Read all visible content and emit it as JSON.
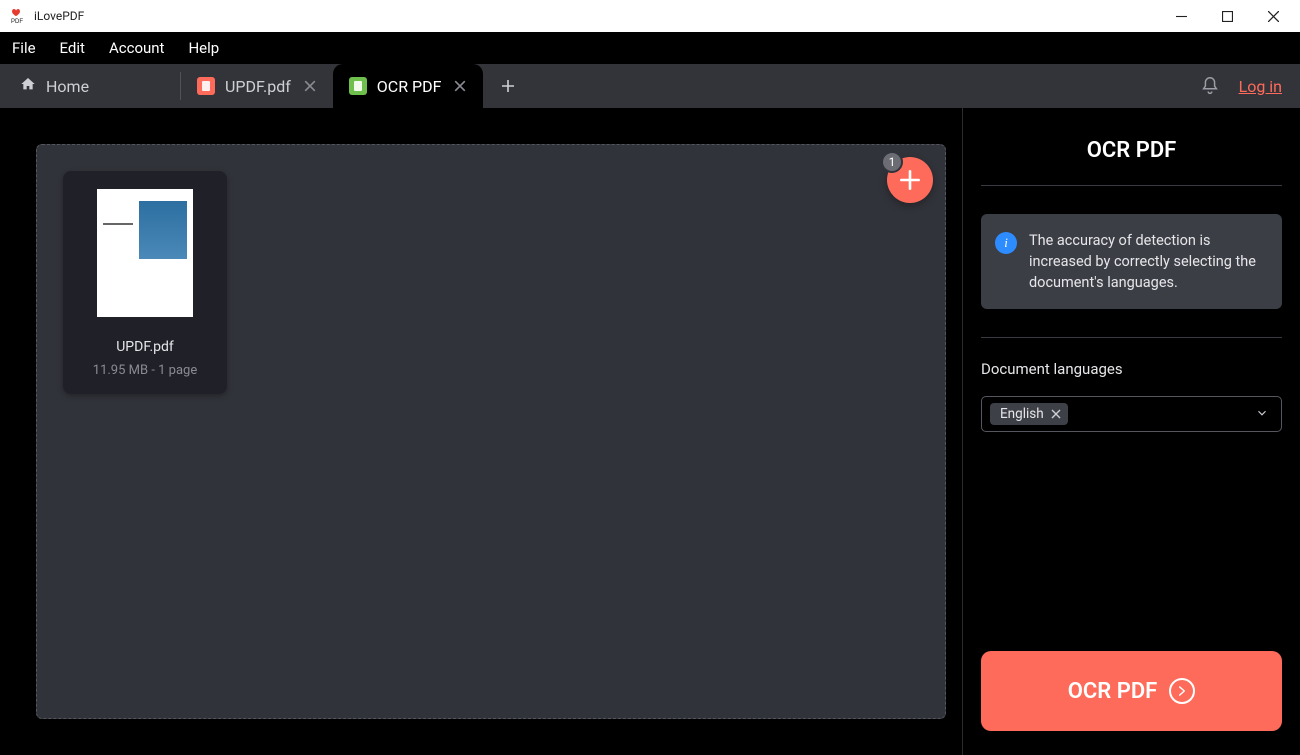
{
  "app": {
    "title": "iLovePDF"
  },
  "menu": {
    "file": "File",
    "edit": "Edit",
    "account": "Account",
    "help": "Help"
  },
  "tabs": {
    "home": "Home",
    "items": [
      {
        "label": "UPDF.pdf",
        "active": false,
        "icon": "pdf"
      },
      {
        "label": "OCR PDF",
        "active": true,
        "icon": "ocr"
      }
    ]
  },
  "header": {
    "login": "Log in"
  },
  "addFab": {
    "count": "1"
  },
  "file": {
    "name": "UPDF.pdf",
    "meta": "11.95 MB - 1 page"
  },
  "sidebar": {
    "title": "OCR PDF",
    "info": "The accuracy of detection is increased by correctly selecting the document's languages.",
    "lang_label": "Document languages",
    "lang_selected": "English",
    "action": "OCR PDF"
  }
}
